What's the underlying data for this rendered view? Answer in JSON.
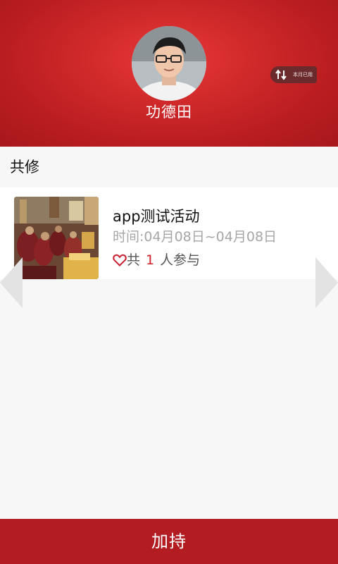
{
  "profile": {
    "name": "功德田",
    "data_usage_label": "本月已用"
  },
  "section": {
    "title": "共修"
  },
  "activities": [
    {
      "title": "app测试活动",
      "time": "时间:04月08日~04月08日",
      "participants_prefix": "共",
      "participants_count": "1",
      "participants_suffix": "人参与"
    }
  ],
  "bottom_bar": {
    "button_label": "加持"
  },
  "colors": {
    "header_red": "#c4242a",
    "bottom_bar_red": "#b31d21",
    "count_red": "#d0202a",
    "muted_text": "#a6a6a6"
  },
  "icons": {
    "traffic": "up-down-arrows-icon",
    "heart": "heart-outline-icon",
    "prev": "chevron-left-icon",
    "next": "chevron-right-icon"
  }
}
